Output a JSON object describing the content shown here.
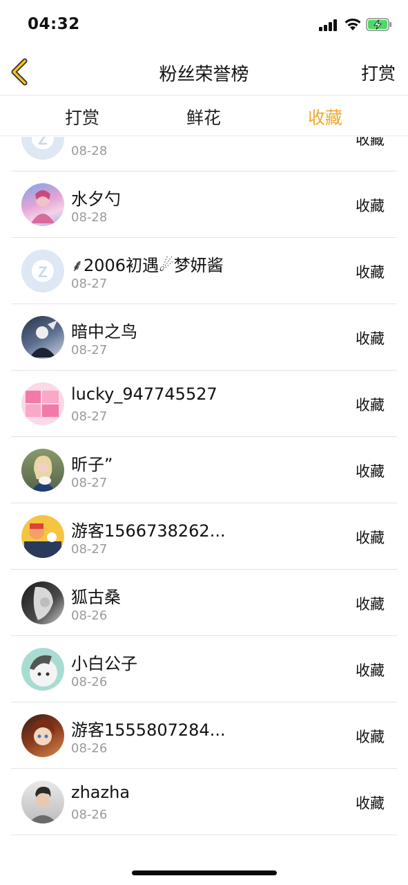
{
  "status_bar": {
    "time": "04:32"
  },
  "nav": {
    "title": "粉丝荣誉榜",
    "right_button": "打赏"
  },
  "tabs": [
    {
      "label": "打赏",
      "active": false
    },
    {
      "label": "鲜花",
      "active": false
    },
    {
      "label": "收藏",
      "active": true
    }
  ],
  "colors": {
    "accent": "#f0a830",
    "divider": "#e3e3e3",
    "date_gray": "#9a9a9a"
  },
  "fans": [
    {
      "name": "",
      "date": "08-28",
      "action": "收藏",
      "avatar_icon": "qq-default-avatar"
    },
    {
      "name": "水夕勺",
      "date": "08-28",
      "action": "收藏",
      "avatar_icon": "anime-avatar"
    },
    {
      "name": "⸙2006初遇☄梦妍酱",
      "date": "08-27",
      "action": "收藏",
      "avatar_icon": "qq-default-avatar"
    },
    {
      "name": "暗中之鸟",
      "date": "08-27",
      "action": "收藏",
      "avatar_icon": "anime-avatar"
    },
    {
      "name": "lucky_947745527",
      "date": "08-27",
      "action": "收藏",
      "avatar_icon": "pink-text-avatar"
    },
    {
      "name": "昕子”",
      "date": "08-27",
      "action": "收藏",
      "avatar_icon": "photo-avatar"
    },
    {
      "name": "游客1566738262...",
      "date": "08-27",
      "action": "收藏",
      "avatar_icon": "cartoon-avatar"
    },
    {
      "name": "狐古桑",
      "date": "08-26",
      "action": "收藏",
      "avatar_icon": "photo-avatar"
    },
    {
      "name": "小白公子",
      "date": "08-26",
      "action": "收藏",
      "avatar_icon": "cartoon-avatar"
    },
    {
      "name": "游客1555807284...",
      "date": "08-26",
      "action": "收藏",
      "avatar_icon": "anime-avatar"
    },
    {
      "name": "zhazha",
      "date": "08-26",
      "action": "收藏",
      "avatar_icon": "photo-avatar"
    }
  ]
}
